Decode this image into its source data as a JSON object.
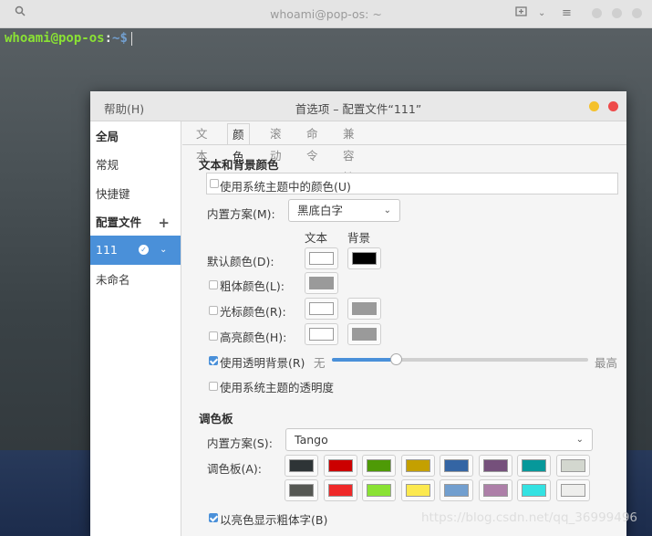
{
  "terminal": {
    "title": "whoami@pop-os: ~",
    "prompt_user": "whoami@pop-os",
    "prompt_sep": ":",
    "prompt_path": "~$",
    "icons": [
      "search-icon",
      "new-tab-icon",
      "chevron-down-icon",
      "hamburger-menu-icon"
    ]
  },
  "dialog": {
    "help_menu": "帮助(H)",
    "title": "首选项 – 配置文件“111”",
    "window_buttons": {
      "minimize_color": "#f4c12c",
      "close_color": "#ee4a4a"
    }
  },
  "sidebar": {
    "global_header": "全局",
    "general": "常规",
    "shortcuts": "快捷键",
    "profiles_header": "配置文件",
    "add_symbol": "+",
    "profiles": [
      "111",
      "未命名"
    ]
  },
  "tabs": [
    "文本",
    "颜色",
    "滚动",
    "命令",
    "兼容性"
  ],
  "active_tab": "颜色",
  "colors": {
    "section_title": "文本和背景颜色",
    "use_system_theme": "使用系统主题中的颜色(U)",
    "builtin_scheme_label": "内置方案(M):",
    "builtin_scheme_value": "黑底白字",
    "col_text": "文本",
    "col_background": "背景",
    "default_color": "默认颜色(D):",
    "bold_color": "粗体颜色(L):",
    "cursor_color": "光标颜色(R):",
    "highlight_color": "高亮颜色(H):",
    "swatches": {
      "default_text": "#ffffff",
      "default_bg": "#000000",
      "bold_text": "#9a9a9a",
      "cursor_text": "#ffffff",
      "cursor_bg": "#9a9a9a",
      "highlight_text": "#ffffff",
      "highlight_bg": "#9a9a9a"
    },
    "use_transparent_bg": "使用透明背景(R)",
    "transparency_min": "无",
    "transparency_max": "最高",
    "transparency_level": 0.25,
    "use_system_transparency": "使用系统主题的透明度"
  },
  "palette": {
    "section_title": "调色板",
    "builtin_scheme_label": "内置方案(S):",
    "builtin_scheme_value": "Tango",
    "palette_label": "调色板(A):",
    "row1": [
      "#2e3436",
      "#cc0000",
      "#4e9a06",
      "#c4a000",
      "#3465a4",
      "#75507b",
      "#06989a",
      "#d3d7cf"
    ],
    "row2": [
      "#555753",
      "#ef2929",
      "#8ae234",
      "#fce94f",
      "#729fcf",
      "#ad7fa8",
      "#34e2e2",
      "#eeeeec"
    ],
    "bold_bright": "以亮色显示粗体字(B)"
  },
  "watermark": "https://blog.csdn.net/qq_36999496"
}
